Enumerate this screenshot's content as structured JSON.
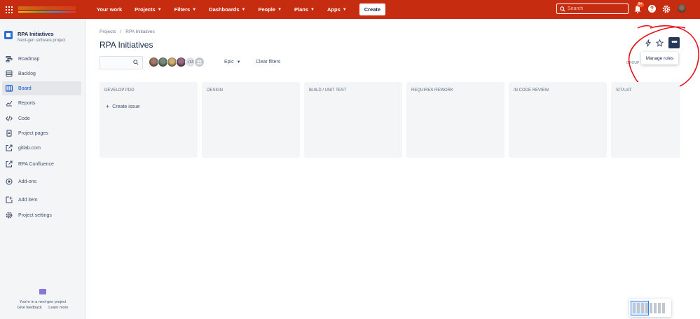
{
  "topnav": {
    "items": [
      {
        "label": "Your work",
        "dropdown": false
      },
      {
        "label": "Projects",
        "dropdown": true
      },
      {
        "label": "Filters",
        "dropdown": true
      },
      {
        "label": "Dashboards",
        "dropdown": true
      },
      {
        "label": "People",
        "dropdown": true
      },
      {
        "label": "Plans",
        "dropdown": true
      },
      {
        "label": "Apps",
        "dropdown": true
      }
    ],
    "create_label": "Create",
    "search_placeholder": "Search",
    "notification_badge": "9+",
    "colors": {
      "bar": "#c62d10",
      "text": "#ffffff"
    }
  },
  "sidebar": {
    "project_name": "RPA Initiatives",
    "project_type": "Next-gen software project",
    "items": [
      {
        "label": "Roadmap",
        "icon": "roadmap-icon"
      },
      {
        "label": "Backlog",
        "icon": "backlog-icon"
      },
      {
        "label": "Board",
        "icon": "board-icon",
        "active": true
      },
      {
        "label": "Reports",
        "icon": "reports-icon"
      },
      {
        "label": "Code",
        "icon": "code-icon"
      },
      {
        "label": "Project pages",
        "icon": "page-icon"
      },
      {
        "label": "gitlab.com",
        "icon": "external-link-icon"
      },
      {
        "label": "RPA Confluence",
        "icon": "external-link-icon"
      },
      {
        "label": "Add-ons",
        "icon": "addons-icon"
      },
      {
        "label": "Add item",
        "icon": "add-item-icon"
      },
      {
        "label": "Project settings",
        "icon": "gear-icon"
      }
    ],
    "footer_text": "You're in a next-gen project",
    "footer_links": [
      "Give feedback",
      "Learn more"
    ]
  },
  "breadcrumb": [
    "Projects",
    "/",
    "RPA Initiatives"
  ],
  "page_title": "RPA Initiatives",
  "toolbar": {
    "menu_item": "Manage rules",
    "group_label": "GROUP"
  },
  "filters": {
    "more_avatars": "+13",
    "epic_label": "Epic",
    "clear_label": "Clear filters"
  },
  "columns": [
    {
      "title": "DEVELOP PDD",
      "create_label": "Create issue"
    },
    {
      "title": "DESIGN"
    },
    {
      "title": "BUILD / UNIT TEST"
    },
    {
      "title": "REQUIRES REWORK"
    },
    {
      "title": "IN CODE REVIEW"
    },
    {
      "title": "SIT/UAT"
    }
  ]
}
